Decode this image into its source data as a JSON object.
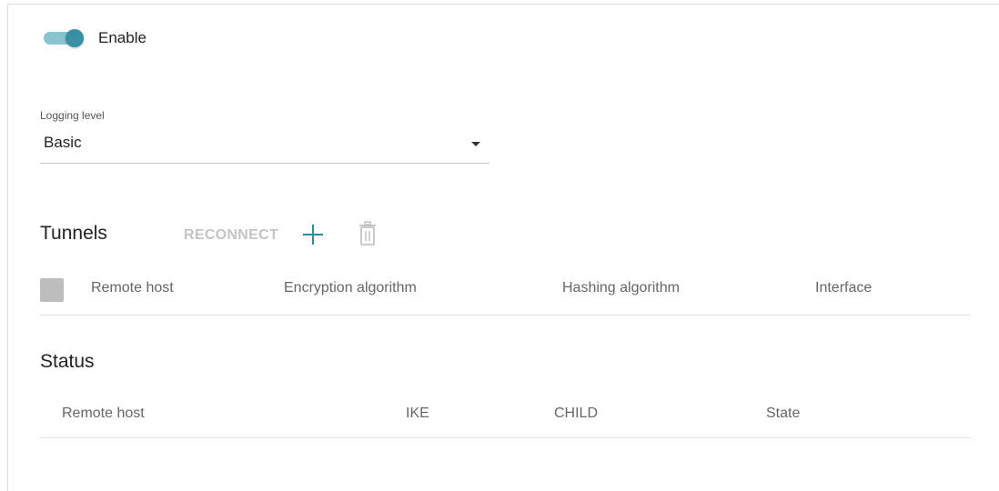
{
  "toggle": {
    "label": "Enable",
    "checked": true,
    "track_color": "#86c4cf",
    "thumb_color": "#3a90a3"
  },
  "logging": {
    "label": "Logging level",
    "value": "Basic"
  },
  "tunnels": {
    "title": "Tunnels",
    "reconnect_label": "RECONNECT",
    "add_icon": "plus-icon",
    "delete_icon": "trash-icon",
    "accent_color": "#2f8aa0",
    "columns": [
      "Remote host",
      "Encryption algorithm",
      "Hashing algorithm",
      "Interface"
    ]
  },
  "status": {
    "title": "Status",
    "columns": [
      "Remote host",
      "IKE",
      "CHILD",
      "State"
    ]
  }
}
